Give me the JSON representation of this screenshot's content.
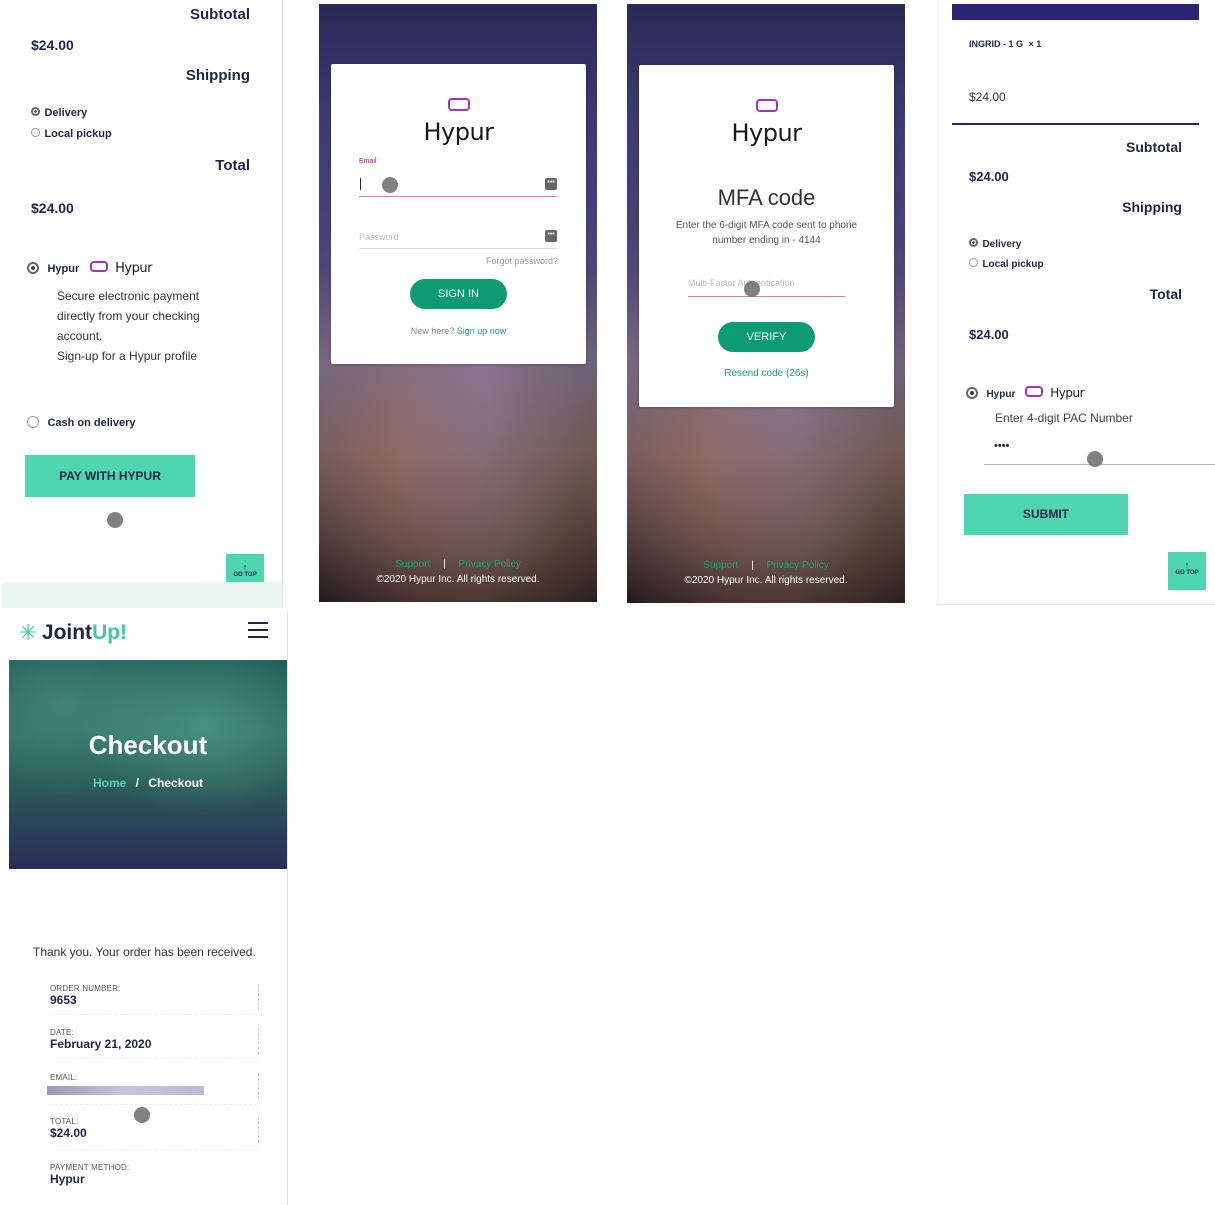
{
  "p1": {
    "subtotal_label": "Subtotal",
    "subtotal_value": "$24.00",
    "shipping_label": "Shipping",
    "shipping_options": [
      "Delivery",
      "Local pickup"
    ],
    "total_label": "Total",
    "total_value": "$24.00",
    "hypur_option": "Hypur",
    "hypur_brand": "Hypur",
    "hypur_desc_1": "Secure electronic payment",
    "hypur_desc_2": "directly from your checking",
    "hypur_desc_3": "account.",
    "hypur_signup": "Sign-up for a Hypur profile",
    "cod_option": "Cash on delivery",
    "pay_button": "PAY WITH HYPUR",
    "gotop_arrow": "↑",
    "gotop_label": "GO TOP"
  },
  "p2": {
    "brand": "Hypur",
    "email_label": "Email",
    "password_placeholder": "Password",
    "forgot": "Forgot password?",
    "signin": "SIGN IN",
    "new_here": "New here?",
    "signup": "Sign up now",
    "support": "Support",
    "sep": "|",
    "privacy": "Privacy Policy",
    "copyright": "©2020 Hypur Inc. All rights reserved."
  },
  "p3": {
    "brand": "Hypur",
    "title": "MFA code",
    "desc_1": "Enter the 6-digit MFA code sent to phone",
    "desc_2": "number ending in - 4144",
    "placeholder": "Multi-Factor Authentication",
    "verify": "VERIFY",
    "resend": "Resend code (26s)",
    "support": "Support",
    "sep": "|",
    "privacy": "Privacy Policy",
    "copyright": "©2020 Hypur Inc. All rights reserved."
  },
  "p4": {
    "item": "INGRID - 1 G",
    "qty": "× 1",
    "item_price": "$24.00",
    "subtotal_label": "Subtotal",
    "subtotal_value": "$24.00",
    "shipping_label": "Shipping",
    "shipping_options": [
      "Delivery",
      "Local pickup"
    ],
    "total_label": "Total",
    "total_value": "$24.00",
    "hypur_option": "Hypur",
    "hypur_brand": "Hypur",
    "pac_label": "Enter 4-digit PAC Number",
    "pac_value": "••••",
    "submit": "SUBMIT",
    "gotop_arrow": "↑",
    "gotop_label": "GO TOP"
  },
  "p5": {
    "logo_joint": "Joint",
    "logo_up": "Up!",
    "hero_title": "Checkout",
    "crumb_home": "Home",
    "crumb_sep": "/",
    "crumb_current": "Checkout",
    "thanks": "Thank you. Your order has been received.",
    "order_label": "ORDER NUMBER:",
    "order_value": "9653",
    "date_label": "DATE:",
    "date_value": "February 21, 2020",
    "email_label": "EMAIL:",
    "total_label": "TOTAL:",
    "total_value": "$24.00",
    "method_label": "PAYMENT METHOD:",
    "method_value": "Hypur"
  },
  "colors": {
    "teal": "#4fd6b0",
    "green": "#0c9b73",
    "navy": "#1e2547",
    "purple": "#a533b8",
    "indigo": "#2b2470"
  }
}
